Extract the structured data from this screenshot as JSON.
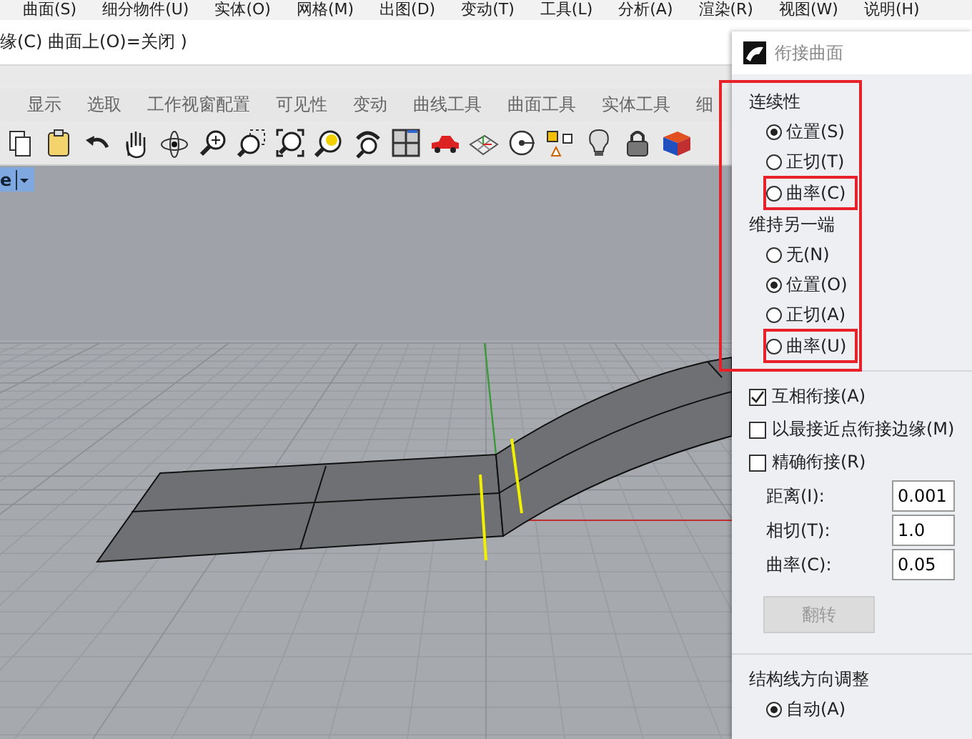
{
  "menu_bar": {
    "items": [
      "曲面(S)",
      "细分物件(U)",
      "实体(O)",
      "网格(M)",
      "出图(D)",
      "变动(T)",
      "工具(L)",
      "分析(A)",
      "渲染(R)",
      "视图(W)",
      "说明(H)"
    ]
  },
  "command_line": {
    "prompt": "缘(C)  曲面上(O)=关闭 )"
  },
  "ribbon_tabs": [
    {
      "label": "显示",
      "selected": false
    },
    {
      "label": "选取",
      "selected": false
    },
    {
      "label": "工作视窗配置",
      "selected": false
    },
    {
      "label": "可见性",
      "selected": false
    },
    {
      "label": "变动",
      "selected": false
    },
    {
      "label": "曲线工具",
      "selected": false
    },
    {
      "label": "曲面工具",
      "selected": false
    },
    {
      "label": "实体工具",
      "selected": false
    },
    {
      "label": "细",
      "selected": false
    }
  ],
  "viewport": {
    "name": "e"
  },
  "dialog": {
    "title": "衔接曲面",
    "groups_highlighted": true,
    "groups": [
      {
        "title": "连续性",
        "options": [
          {
            "label": "位置(S)",
            "selected": true,
            "highlighted": false
          },
          {
            "label": "正切(T)",
            "selected": false,
            "highlighted": false
          },
          {
            "label": "曲率(C)",
            "selected": false,
            "highlighted": true
          }
        ]
      },
      {
        "title": "维持另一端",
        "options": [
          {
            "label": "无(N)",
            "selected": false,
            "highlighted": false
          },
          {
            "label": "位置(O)",
            "selected": true,
            "highlighted": false
          },
          {
            "label": "正切(A)",
            "selected": false,
            "highlighted": false
          },
          {
            "label": "曲率(U)",
            "selected": false,
            "highlighted": true
          }
        ]
      }
    ],
    "checkboxes": [
      {
        "label": "互相衔接(A)",
        "checked": true
      },
      {
        "label": "以最接近点衔接边缘(M)",
        "checked": false
      },
      {
        "label": "精确衔接(R)",
        "checked": false
      }
    ],
    "fields": [
      {
        "label": "距离(I):",
        "value": "0.001"
      },
      {
        "label": "相切(T):",
        "value": "1.0"
      },
      {
        "label": "曲率(C):",
        "value": "0.05"
      }
    ],
    "button": {
      "label": "翻转",
      "disabled": true
    },
    "direction_group": {
      "title": "结构线方向调整",
      "options": [
        {
          "label": "自动(A)",
          "selected": true
        }
      ]
    }
  }
}
